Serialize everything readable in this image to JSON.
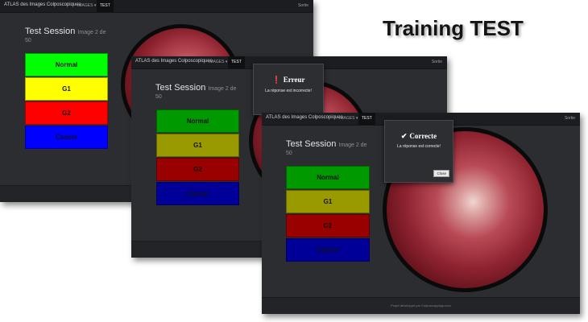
{
  "headline": "Training TEST",
  "screens": [
    {
      "brand": "ATLAS des Images Colposcopiques",
      "nav": {
        "images_label": "IMAGES ▾",
        "test_label": "TEST",
        "right_label": "Sortie"
      },
      "session": {
        "title": "Test Session",
        "subtitle": "Image 2 de",
        "subtitle_line2": "50"
      },
      "choices": [
        {
          "label": "Normal",
          "color": "#00ff00"
        },
        {
          "label": "G1",
          "color": "#ffff00"
        },
        {
          "label": "G2",
          "color": "#ff0000"
        },
        {
          "label": "Cancer",
          "color": "#0000ff"
        }
      ]
    },
    {
      "brand": "ATLAS des Images Colposcopiques",
      "nav": {
        "images_label": "IMAGES ▾",
        "test_label": "TEST",
        "right_label": "Sortie"
      },
      "session": {
        "title": "Test Session",
        "subtitle": "Image 2 de",
        "subtitle_line2": "50"
      },
      "choices": [
        {
          "label": "Normal",
          "color": "#009900"
        },
        {
          "label": "G1",
          "color": "#999900"
        },
        {
          "label": "G2",
          "color": "#990000"
        },
        {
          "label": "Cancer",
          "color": "#000099"
        }
      ],
      "dialog": {
        "icon": "info-icon",
        "title": "Erreur",
        "message": "La réponse est incorrecte!"
      }
    },
    {
      "brand": "ATLAS des Images Colposcopiques",
      "nav": {
        "images_label": "IMAGES ▾",
        "test_label": "TEST",
        "right_label": "Sortie"
      },
      "session": {
        "title": "Test Session",
        "subtitle": "Image 2 de",
        "subtitle_line2": "50"
      },
      "choices": [
        {
          "label": "Normal",
          "color": "#009900"
        },
        {
          "label": "G1",
          "color": "#999900"
        },
        {
          "label": "G2",
          "color": "#990000"
        },
        {
          "label": "Cancer",
          "color": "#000099"
        }
      ],
      "dialog": {
        "icon": "checkmark-icon",
        "title": "Correcte",
        "message": "La réponse est correcte!",
        "close_label": "Close"
      },
      "footer": "Projet développé par ColposcopyApp.com"
    }
  ]
}
